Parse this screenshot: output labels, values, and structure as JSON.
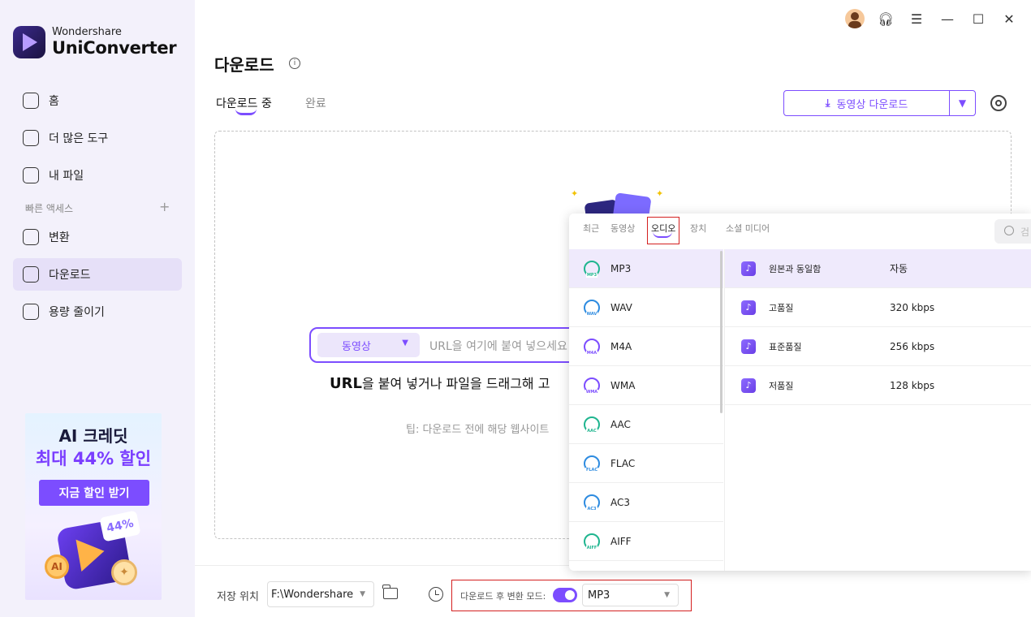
{
  "app": {
    "brand_top": "Wondershare",
    "brand_main": "UniConverter"
  },
  "sidebar": {
    "items": [
      {
        "label": "홈"
      },
      {
        "label": "더 많은 도구"
      },
      {
        "label": "내 파일"
      },
      {
        "label": "변환"
      },
      {
        "label": "다운로드"
      },
      {
        "label": "용량 줄이기"
      }
    ],
    "quick_access": "빠른 액세스",
    "quick_add": "+"
  },
  "promo": {
    "line1": "AI 크레딧",
    "line2": "최대 44% 할인",
    "button": "지금 할인 받기",
    "tag": "44%"
  },
  "page": {
    "title": "다운로드"
  },
  "tabs": {
    "active": "다운로드 중",
    "inactive": "완료"
  },
  "download_button": {
    "label": "동영상 다운로드"
  },
  "url_input": {
    "type": "동영상",
    "placeholder": "URL을 여기에 붙여 넣으세요"
  },
  "hint": {
    "bold": "URL",
    "main": "을 붙여 넣거나 파일을 드래그해 고",
    "tip": "팁: 다운로드 전에 해당 웹사이트"
  },
  "bottom": {
    "save_label": "저장 위치",
    "save_path": "F:\\Wondershare",
    "mode_label": "다운로드 후 변환 모드:",
    "mode_value": "MP3"
  },
  "popup": {
    "tabs": [
      "최근",
      "동영상",
      "오디오",
      "장치",
      "소셜 미디어"
    ],
    "search_placeholder": "검",
    "formats": [
      {
        "name": "MP3",
        "code": "MP3",
        "color": "#1fb58f"
      },
      {
        "name": "WAV",
        "code": "WAV",
        "color": "#2d8be0"
      },
      {
        "name": "M4A",
        "code": "M4A",
        "color": "#7c4dff"
      },
      {
        "name": "WMA",
        "code": "WMA",
        "color": "#7c4dff"
      },
      {
        "name": "AAC",
        "code": "AAC",
        "color": "#1fb58f"
      },
      {
        "name": "FLAC",
        "code": "FLAC",
        "color": "#2d8be0"
      },
      {
        "name": "AC3",
        "code": "AC3",
        "color": "#2d8be0"
      },
      {
        "name": "AIFF",
        "code": "AIFF",
        "color": "#1fb58f"
      }
    ],
    "qualities": [
      {
        "name": "원본과 동일함",
        "value": "자동"
      },
      {
        "name": "고품질",
        "value": "320 kbps"
      },
      {
        "name": "표준품질",
        "value": "256 kbps"
      },
      {
        "name": "저품질",
        "value": "128 kbps"
      }
    ]
  },
  "colors": {
    "accent": "#7c4dff",
    "highlight": "#d42020",
    "sidebar_bg": "#f3f1fb"
  }
}
